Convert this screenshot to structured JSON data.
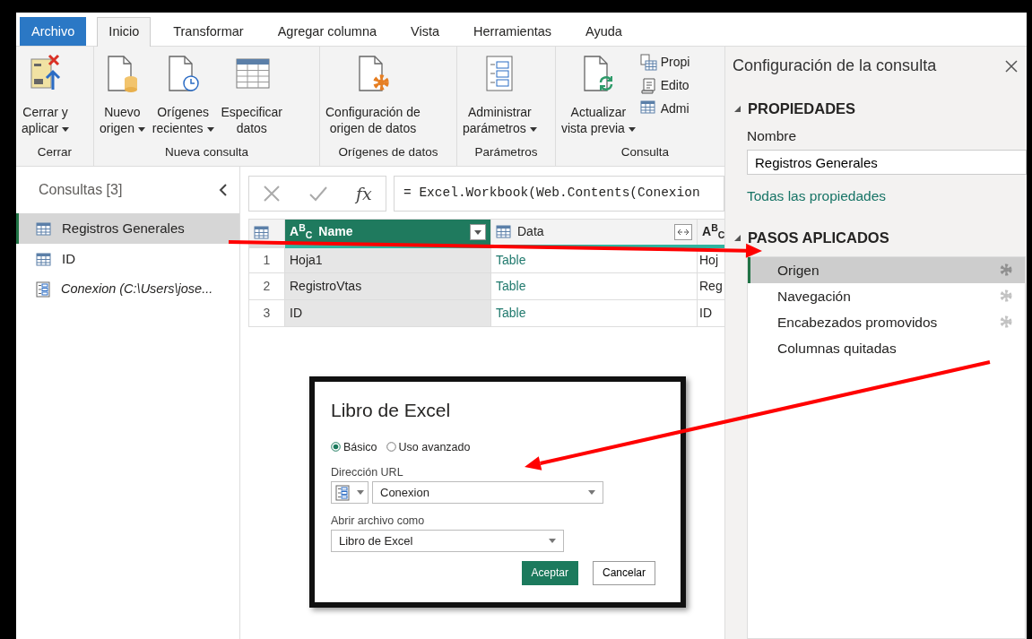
{
  "ribbon": {
    "tabs": [
      {
        "label": "Archivo",
        "kind": "file",
        "selected": false
      },
      {
        "label": "Inicio",
        "kind": "tab",
        "selected": true
      },
      {
        "label": "Transformar",
        "kind": "tab",
        "selected": false
      },
      {
        "label": "Agregar columna",
        "kind": "tab",
        "selected": false
      },
      {
        "label": "Vista",
        "kind": "tab",
        "selected": false
      },
      {
        "label": "Herramientas",
        "kind": "tab",
        "selected": false
      },
      {
        "label": "Ayuda",
        "kind": "tab",
        "selected": false
      }
    ],
    "groups": [
      {
        "label": "Cerrar",
        "buttons": [
          {
            "kind": "large",
            "lines": [
              "Cerrar y",
              "aplicar"
            ],
            "dropdown": true
          }
        ]
      },
      {
        "label": "Nueva consulta",
        "buttons": [
          {
            "kind": "large",
            "lines": [
              "Nuevo",
              "origen"
            ],
            "dropdown": true
          },
          {
            "kind": "large",
            "lines": [
              "Orígenes",
              "recientes"
            ],
            "dropdown": true
          },
          {
            "kind": "large",
            "lines": [
              "Especificar",
              "datos"
            ],
            "dropdown": false
          }
        ]
      },
      {
        "label": "Orígenes de datos",
        "buttons": [
          {
            "kind": "large",
            "lines": [
              "Configuración de",
              "origen de datos"
            ],
            "dropdown": false
          }
        ]
      },
      {
        "label": "Parámetros",
        "buttons": [
          {
            "kind": "large",
            "lines": [
              "Administrar",
              "parámetros"
            ],
            "dropdown": true
          }
        ]
      },
      {
        "label": "Consulta",
        "buttons": [
          {
            "kind": "large",
            "lines": [
              "Actualizar",
              "vista previa"
            ],
            "dropdown": true
          },
          {
            "kind": "small",
            "lines": [
              "Propi"
            ],
            "dropdown": false
          },
          {
            "kind": "small",
            "lines": [
              "Edito"
            ],
            "dropdown": false
          },
          {
            "kind": "small",
            "lines": [
              "Admi"
            ],
            "dropdown": false
          }
        ]
      }
    ]
  },
  "queries": {
    "title": "Consultas [3]",
    "items": [
      {
        "label": "Registros Generales",
        "kind": "table",
        "selected": true
      },
      {
        "label": "ID",
        "kind": "table",
        "selected": false
      },
      {
        "label": "Conexion (C:\\Users\\jose...",
        "kind": "parameter",
        "selected": false
      }
    ]
  },
  "formula_bar": {
    "function_label": "fx",
    "formula": "= Excel.Workbook(Web.Contents(Conexion"
  },
  "grid": {
    "columns": [
      {
        "kind": "text",
        "type_label": "A$^{B}$$_{C}$",
        "name": "Name",
        "selected": true
      },
      {
        "kind": "table",
        "name": "Data",
        "selected": false
      },
      {
        "kind": "text",
        "type_label": "A$^{B}$$_{C}$",
        "selected": false
      }
    ],
    "rows": [
      {
        "index": "1",
        "cells": [
          "Hoja1",
          "Table",
          "Hoj"
        ]
      },
      {
        "index": "2",
        "cells": [
          "RegistroVtas",
          "Table",
          "Reg"
        ]
      },
      {
        "index": "3",
        "cells": [
          "ID",
          "Table",
          "ID"
        ]
      }
    ]
  },
  "settings": {
    "title": "Configuración de la consulta",
    "properties_heading": "PROPIEDADES",
    "name_label": "Nombre",
    "name_value": "Registros Generales",
    "all_properties_link": "Todas las propiedades",
    "steps_heading": "PASOS APLICADOS",
    "steps": [
      {
        "label": "Origen",
        "selected": true,
        "has_settings": true
      },
      {
        "label": "Navegación",
        "selected": false,
        "has_settings": true
      },
      {
        "label": "Encabezados promovidos",
        "selected": false,
        "has_settings": true
      },
      {
        "label": "Columnas quitadas",
        "selected": false,
        "has_settings": false
      }
    ]
  },
  "dialog": {
    "title": "Libro de Excel",
    "modes": [
      {
        "label": "Básico",
        "selected": true
      },
      {
        "label": "Uso avanzado",
        "selected": false
      }
    ],
    "url_label": "Dirección URL",
    "url_value": "Conexion",
    "open_as_label": "Abrir archivo como",
    "open_as_value": "Libro de Excel",
    "buttons": [
      {
        "label": "Aceptar",
        "kind": "primary"
      },
      {
        "label": "Cancelar",
        "kind": "secondary"
      }
    ]
  }
}
